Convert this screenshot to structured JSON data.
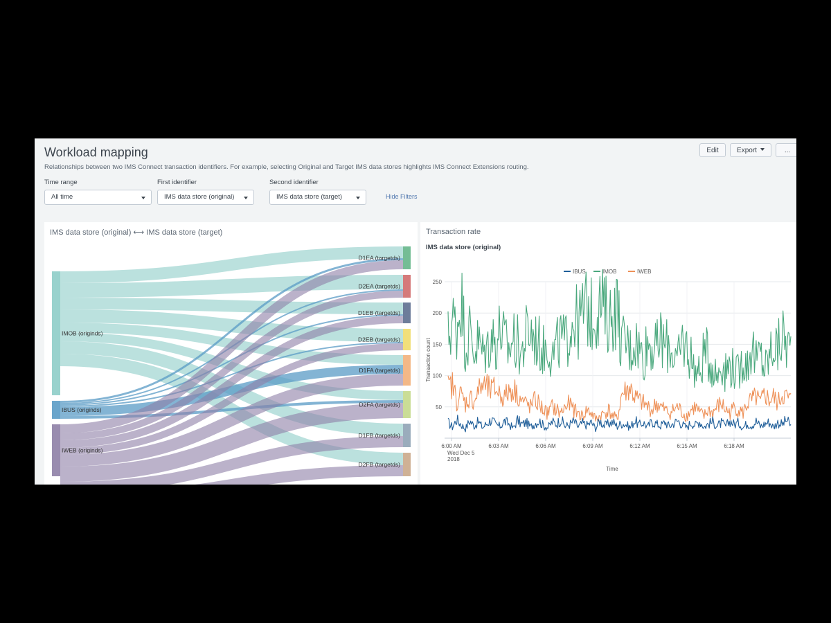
{
  "header": {
    "title": "Workload mapping",
    "description": "Relationships between two IMS Connect transaction identifiers. For example, selecting Original and Target IMS data stores highlights IMS Connect Extensions routing.",
    "edit_label": "Edit",
    "export_label": "Export",
    "more_label": "..."
  },
  "filters": {
    "time_range": {
      "label": "Time range",
      "value": "All time"
    },
    "first_identifier": {
      "label": "First identifier",
      "value": "IMS data store (original)"
    },
    "second_identifier": {
      "label": "Second identifier",
      "value": "IMS data store (target)"
    },
    "hide_label": "Hide Filters"
  },
  "sankey_panel": {
    "title": "IMS data store (original) ⟷ IMS data store (target)",
    "sources": [
      {
        "label": "IMOB (originds)",
        "color": "#8ecdc8"
      },
      {
        "label": "IBUS (originds)",
        "color": "#5a9bc5"
      },
      {
        "label": "IWEB (originds)",
        "color": "#8e7fa6"
      }
    ],
    "targets": [
      {
        "label": "D1EA (targetds)",
        "color": "#65b68a"
      },
      {
        "label": "D2EA (targetds)",
        "color": "#d06b6b"
      },
      {
        "label": "D1EB (targetds)",
        "color": "#5d6e8f"
      },
      {
        "label": "D2EB (targetds)",
        "color": "#f0dc6c"
      },
      {
        "label": "D1FA (targetds)",
        "color": "#f2b07a"
      },
      {
        "label": "D2FA (targetds)",
        "color": "#c4d98b"
      },
      {
        "label": "D1FB (targetds)",
        "color": "#8fa3b5"
      },
      {
        "label": "D2FB (targetds)",
        "color": "#caa88a"
      }
    ]
  },
  "rate_panel": {
    "title": "Transaction rate",
    "subtitle": "IMS data store (original)"
  },
  "chart_data": {
    "type": "line",
    "xlabel": "Time",
    "ylabel": "Transaction count",
    "ylim": [
      0,
      250
    ],
    "yticks": [
      50,
      100,
      150,
      200,
      250
    ],
    "xticks": [
      "6:00 AM",
      "6:03 AM",
      "6:06 AM",
      "6:09 AM",
      "6:12 AM",
      "6:15 AM",
      "6:18 AM"
    ],
    "xtick_first_date": [
      "Wed Dec 5",
      "2018"
    ],
    "grid": true,
    "legend_position": "top-center",
    "series": [
      {
        "name": "IBUS",
        "color": "#1f5e99",
        "values": [
          25,
          18,
          30,
          22,
          15,
          28,
          20,
          26,
          17,
          24,
          30,
          21,
          19,
          27,
          23,
          16,
          29,
          22,
          25,
          18,
          24,
          28,
          20,
          17,
          26,
          23,
          30,
          19,
          22,
          27,
          18,
          24,
          21,
          25,
          16,
          28,
          20,
          23,
          26,
          19,
          24,
          22,
          17,
          29,
          21,
          25,
          18,
          27,
          23,
          20,
          26,
          19,
          24,
          28,
          22,
          17,
          25,
          21,
          27,
          18,
          23,
          26,
          20,
          24,
          19,
          28,
          22,
          25,
          17,
          24,
          21,
          27,
          19,
          23,
          26,
          18,
          25,
          22,
          29,
          20
        ]
      },
      {
        "name": "IMOB",
        "color": "#4aa87d",
        "values": [
          160,
          190,
          175,
          230,
          150,
          170,
          140,
          155,
          135,
          145,
          165,
          150,
          175,
          155,
          140,
          160,
          150,
          135,
          165,
          170,
          160,
          150,
          140,
          155,
          130,
          145,
          160,
          150,
          175,
          195,
          180,
          200,
          210,
          195,
          200,
          215,
          205,
          190,
          200,
          210,
          150,
          155,
          140,
          160,
          145,
          130,
          155,
          150,
          140,
          160,
          145,
          150,
          135,
          120,
          155,
          145,
          130,
          110,
          100,
          140,
          130,
          115,
          100,
          125,
          105,
          120,
          110,
          100,
          130,
          115,
          150,
          120,
          135,
          110,
          130,
          150,
          140,
          165,
          150,
          140
        ]
      },
      {
        "name": "IWEB",
        "color": "#ee9158",
        "values": [
          80,
          85,
          60,
          70,
          55,
          65,
          60,
          75,
          85,
          80,
          75,
          80,
          70,
          65,
          75,
          80,
          70,
          60,
          55,
          50,
          60,
          55,
          45,
          40,
          50,
          45,
          40,
          50,
          55,
          45,
          40,
          35,
          45,
          40,
          30,
          35,
          40,
          45,
          35,
          30,
          70,
          75,
          80,
          65,
          60,
          55,
          50,
          45,
          55,
          50,
          45,
          40,
          45,
          50,
          40,
          35,
          45,
          50,
          40,
          35,
          45,
          40,
          50,
          55,
          45,
          40,
          50,
          45,
          40,
          55,
          60,
          65,
          55,
          70,
          60,
          65,
          55,
          70,
          65,
          60
        ]
      }
    ]
  }
}
